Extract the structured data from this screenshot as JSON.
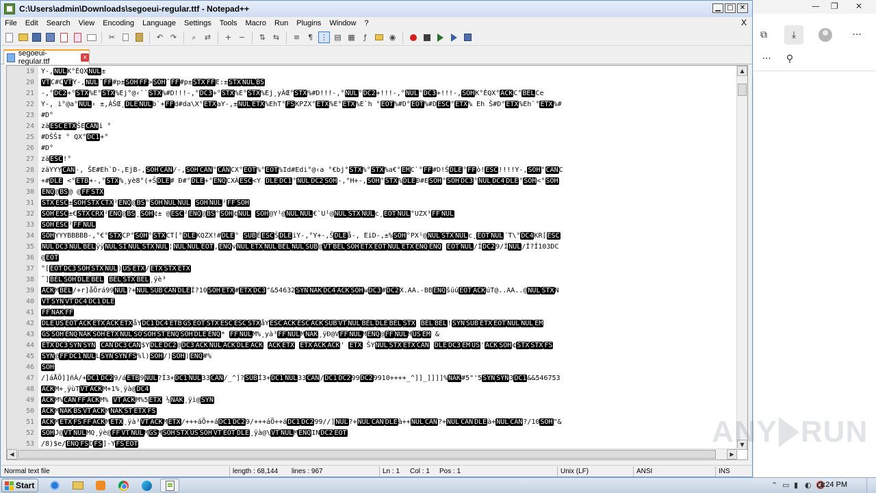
{
  "window": {
    "title": "C:\\Users\\admin\\Downloads\\segoeui-regular.ttf - Notepad++",
    "minimize_glyph": "▁",
    "maximize_glyph": "□",
    "close_glyph": "✕"
  },
  "menu": {
    "items": [
      "File",
      "Edit",
      "Search",
      "View",
      "Encoding",
      "Language",
      "Settings",
      "Tools",
      "Macro",
      "Run",
      "Plugins",
      "Window",
      "?"
    ],
    "close_glyph": "X"
  },
  "toolbar": {
    "icons": [
      "new-file-icon",
      "open-file-icon",
      "save-icon",
      "save-all-icon",
      "close-icon",
      "close-all-icon",
      "print-icon",
      "cut-icon",
      "copy-icon",
      "paste-icon",
      "undo-icon",
      "redo-icon",
      "find-icon",
      "replace-icon",
      "zoom-in-icon",
      "zoom-out-icon",
      "sync-v-icon",
      "sync-h-icon",
      "word-wrap-icon",
      "all-chars-icon",
      "indent-guide-icon",
      "lang-icon",
      "doc-map-icon",
      "func-list-icon",
      "folder-workspace-icon",
      "monitor-icon",
      "record-macro-icon",
      "stop-macro-icon",
      "play-macro-icon",
      "play-multi-icon",
      "save-macro-icon"
    ]
  },
  "tab": {
    "label": "segoeui-regular.ttf",
    "close_glyph": "x"
  },
  "editor": {
    "lines": [
      {
        "n": "19",
        "text": "Y-,NULK°ÈQXNUL±"
      },
      {
        "n": "20",
        "text": "VTC#CVTY-,NUL˝FF#p±SOHFF>SOH˝FF#p±STXFFE:±STXNULBS"
      },
      {
        "n": "21",
        "text": "-,°DC2+°STX%E°STX%Ej°@‹``STX%#D!!!-,°DC3+°STX%E°STX%Ej¸yÀŒ°STX%#D!!!-,°NUL°DC2+!!!-,°NUL°DC3+!!!-,SOHK°ÈQX°ACKC°BELCe"
      },
      {
        "n": "22",
        "text": "Y-, i°@a°NUL‹ ±,ÀŠŒ¸DLENULb`+FFd#da\\X°ETXaY-,±NULETX%EhT°FSKPZX°ETX%E°ETX%E`h °EOT%#D°EOT%#DESC°ETX% Eh Š#D°ETX%Eh`°ETX%#"
      },
      {
        "n": "23",
        "text": "#D°"
      },
      {
        "n": "24",
        "text": "zäESCETXŠECANi °"
      },
      {
        "n": "25",
        "text": "#DŠŠ‡ ° QX°DC1+°"
      },
      {
        "n": "26",
        "text": "#D°"
      },
      {
        "n": "27",
        "text": "zäESC!°"
      },
      {
        "n": "28",
        "text": "zäYYYCAN-, ŠE#Eh`D-,EjB-,SOHCAN/-,SOHCAN°CANCX°EOT%°EOT%Id#Edi°@‹a °€bj°STX%°STX%a€°EMC`°FF#D!ŠDLE°FFò!ESC!!!!Y-,SOH°CANC"
      },
      {
        "n": "29",
        "text": "+#DLE <°ETB+-,°STX%¸yè8°(+ŠDLE# Ð#°DLE+°ENQCXÀESC<Y DLEDC1°NULDC2SOH-,°H+-,SOH°STX%DLEÐ#ESOH°SOHDC3°NULDC4DLE°SOH<°SOH"
      },
      {
        "n": "30",
        "text": "ENQ@BS@    @FFSTX"
      },
      {
        "n": "31",
        "text": "STXESC±SOHSTXCTX²ENQ@BS°SOHNULNUL    SOHNUL²FFSOH"
      },
      {
        "n": "32",
        "text": "SOHESC±€STXCRX²ENQ@BS¸SOH¢±   @ESC²ENQ@BS°SOH¢NUL    SOH@Y¹@NULNUL€`U¹@NULSTXNULc¸EOTNUL°UZX³FFNUL"
      },
      {
        "n": "33",
        "text": "SOHESC²FFNUL"
      },
      {
        "n": "34",
        "text": "SOHYYYBBBBB-,°€°STXCP°SOH°STXCT[°DLEKQZX!#DLE°  SUBÉESCŠDLEiY-,°Y+-,ŠDLEå-, EiD-,±%SOH°PX¹@NULSTXNULc¸EOTNUL´T\\°DC4KR[ESC"
      },
      {
        "n": "35",
        "text": "NULDC3NULBELÿÿNULSINULSTXNUL¦NULNULEOT,ENQvNULETXNULBELNULSUB@VTBELSOHETXEOTNULETXENQENQ  EOTNUL/ÍDC29/ÍNUL/Í?Í103DC"
      },
      {
        "n": "36",
        "text": "@EOT"
      },
      {
        "n": "37",
        "text": "°[EOTDC3SOHSTXNUL)USETX/ETXSTXETX"
      },
      {
        "n": "38",
        "text": "¯]BELSOHDLEBEL BELSTXBEL¸ÿè³"
      },
      {
        "n": "39",
        "text": "ACKMBEL/+r]åÖrá99NUL?+NULSUBCANDLEÍ?10SOHETX#ETXDC3\"&54632SYNNAKDC4ACKSOHwDC3#DC2X.AA.-BBENQšúúEOTACKúT@..AA..@NULSTXN"
      },
      {
        "n": "40",
        "text": "VTSYNVTDC4DC1DLE"
      },
      {
        "n": "41",
        "text": "FFNAKFF"
      },
      {
        "n": "42",
        "text": "DLEUSEOTACKETXACKETXåYDC1DC4ETBGSEOTSTXESCESCSTXåYESCACKESCACKSUBVTNULBELDLEBELSTX     BELBEL!SYNSUBETXEOTNULNULEM"
      },
      {
        "n": "43",
        "text": "GSSOHENQNAKSOHETXNULSOSOHSTENQSOHDLEENQ*  FFNULM%¸yà³FFNULMNAK¸ÿÐ@VFFNULMENQ@FFNULMUSEM       &"
      },
      {
        "n": "44",
        "text": "ETXDC3SYNSYN  CANDC3CAN$YDLEDC2@DC3ACKNULACKDLEACK  ACKETX   ETXACKACK'  ETX ŠYNULSTXETXCAN DLEDC3EMUS'ACKSOH¢STXSTXFS"
      },
      {
        "n": "45",
        "text": "SYN@FFDC1NULLSYNSYNFS%l)SOH/)SOH)ENQ#%"
      },
      {
        "n": "46",
        "text": "SOH"
      },
      {
        "n": "47",
        "text": "/]áÅÖ]]ñÀ/+DC1DC29/áETB9NUL?Í3+DC1NUL33CAN/_^]?SUBÍ3+DC1NUL33CAN/DC1DC299DC29910++++_^]]_]]]]%NAK#5\"'5SYNSYN3DC1&&546753"
      },
      {
        "n": "48",
        "text": "ACKM+¸ÿùTVTACKM+1%¸ÿà@DC4"
      },
      {
        "n": "49",
        "text": "ACKM%CANFFACKM%     VTACKM%5ETX    ½NAK¸ÿi@SYN"
      },
      {
        "n": "50",
        "text": "ACKMNAKBSVTACKMNAKSTETXFS"
      },
      {
        "n": "51",
        "text": "ACKMETXFSFFACKMETX¸ÿà³VTACKMETX/+++áÖ++áDC1DC29/+++áÖ++áDC1DC299//]NUL?+NULCANDLEà++NULCAN?+NULCANDLEà+NULCAN?/10SOH\"&"
      },
      {
        "n": "52",
        "text": "SOHJ@VTNULMQ¸ÿè@FFVTNULMGSMSOHSTXUSSOHVTEOTDLE¸ÿà@\\VTNULMENQINDC2EOT"
      },
      {
        "n": "53",
        "text": "/8)$e/ENQFSDFS]-YFSEOT"
      }
    ]
  },
  "statusbar": {
    "type": "Normal text file",
    "length": "length : 68,144",
    "lines": "lines : 967",
    "ln": "Ln : 1",
    "col": "Col : 1",
    "pos": "Pos : 1",
    "eol": "Unix (LF)",
    "encoding": "ANSI",
    "mode": "INS"
  },
  "browser": {
    "min_glyph": "—",
    "max_glyph": "❐",
    "close_glyph": "✕",
    "more_glyph": "···",
    "pin_glyph": "⚲"
  },
  "watermark": {
    "text_left": "ANY",
    "text_right": "RUN"
  },
  "taskbar": {
    "start_label": "Start",
    "tray_glyphs": [
      "⌃",
      "▭",
      "▮",
      "◐",
      "🔇"
    ],
    "clock": "1:24 PM"
  }
}
